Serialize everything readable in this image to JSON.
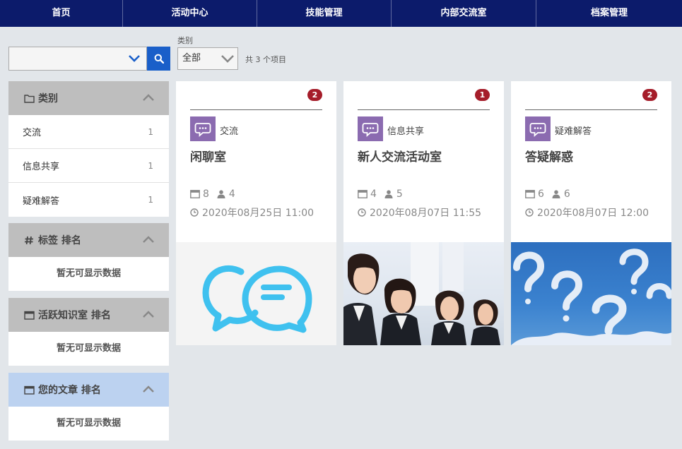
{
  "nav": {
    "items": [
      {
        "label": "首页"
      },
      {
        "label": "活动中心"
      },
      {
        "label": "技能管理"
      },
      {
        "label": "内部交流室"
      },
      {
        "label": "档案管理"
      }
    ]
  },
  "search": {
    "value": "",
    "placeholder": ""
  },
  "filter": {
    "label": "类别",
    "selected": "全部",
    "count_text": "共 3 个项目"
  },
  "sidebar": {
    "categories": {
      "title": "类别",
      "items": [
        {
          "label": "交流",
          "count": "1"
        },
        {
          "label": "信息共享",
          "count": "1"
        },
        {
          "label": "疑难解答",
          "count": "1"
        }
      ]
    },
    "tags": {
      "title": "标签 排名",
      "empty": "暂无可显示数据"
    },
    "active_rooms": {
      "title": "活跃知识室 排名",
      "empty": "暂无可显示数据"
    },
    "my_articles": {
      "title": "您的文章 排名",
      "empty": "暂无可显示数据"
    }
  },
  "cards": [
    {
      "badge": "2",
      "category": "交流",
      "title": "闲聊室",
      "posts": "8",
      "members": "4",
      "time": "2020年08月25日 11:00",
      "image": "chat-bubbles-icon"
    },
    {
      "badge": "1",
      "category": "信息共享",
      "title": "新人交流活动室",
      "posts": "4",
      "members": "5",
      "time": "2020年08月07日 11:55",
      "image": "new-employees-photo"
    },
    {
      "badge": "2",
      "category": "疑难解答",
      "title": "答疑解惑",
      "posts": "6",
      "members": "6",
      "time": "2020年08月07日 12:00",
      "image": "cloud-question-marks-photo"
    }
  ],
  "colors": {
    "nav_bg": "#0c1b6b",
    "accent_blue": "#1a5fc9",
    "badge_red": "#a51d2a",
    "category_purple": "#8b6bb0",
    "panel_grey": "#bebebe",
    "panel_blue": "#bcd2f0"
  }
}
